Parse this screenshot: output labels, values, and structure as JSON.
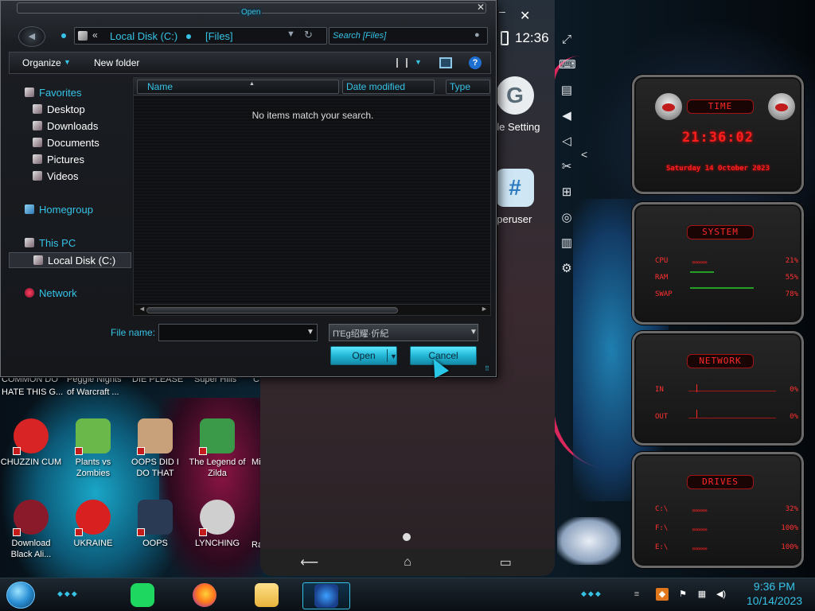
{
  "dialog": {
    "title": "Open",
    "address": {
      "crumb1": "Local Disk (C:)",
      "crumb2": "[Files]",
      "back_glyph": "«"
    },
    "search": {
      "placeholder": "Search [Files]"
    },
    "toolbar": {
      "organize_label": "Organize",
      "new_folder_label": "New folder",
      "help_glyph": "?"
    },
    "nav": {
      "favorites": "Favorites",
      "desktop": "Desktop",
      "downloads": "Downloads",
      "documents": "Documents",
      "pictures": "Pictures",
      "videos": "Videos",
      "homegroup": "Homegroup",
      "this_pc": "This PC",
      "local_disk": "Local Disk (C:)",
      "network": "Network"
    },
    "columns": {
      "name": "Name",
      "date_modified": "Date modified",
      "type": "Type"
    },
    "empty_message": "No items match your search.",
    "file_name_label": "File name:",
    "file_name_value": "",
    "file_type_value": "ΠΈg绍耀·伒紀",
    "open_label": "Open",
    "cancel_label": "Cancel"
  },
  "emulator": {
    "status_time": "12:36",
    "apps": {
      "google_settings": "gle Setting",
      "superuser": "uperuser",
      "google_glyph": "G",
      "superuser_glyph": "#"
    },
    "nav": {
      "back": "⟵",
      "home": "⌂",
      "recents": "▭"
    },
    "toolbar": [
      "⤢",
      "⌨",
      "▤",
      "◀",
      "◁",
      "✂",
      "⊞",
      "◎",
      "▥",
      "⚙"
    ],
    "close_glyph": "✕",
    "minimize_glyph": "–",
    "collapse_glyph": "<"
  },
  "sysmon": {
    "time_title": "TIME",
    "clock": "21:36:02",
    "date": "Saturday 14 October 2023",
    "system_title": "SYSTEM",
    "cpu_label": "CPU",
    "cpu_value": "21%",
    "ram_label": "RAM",
    "ram_value": "55%",
    "swap_label": "SWAP",
    "swap_value": "78%",
    "network_title": "NETWORK",
    "in_label": "IN",
    "in_value": "0%",
    "out_label": "OUT",
    "out_value": "0%",
    "drives_title": "DRIVES",
    "c_label": "C:\\",
    "c_value": "32%",
    "f_label": "F:\\",
    "f_value": "100%",
    "e_label": "E:\\",
    "e_value": "100%",
    "bar_glyphs": "»»»»»"
  },
  "desktop": {
    "partial_labels": [
      "COMMON DO",
      "Peggle Nights",
      "DIE PLEASE",
      "Super Hills",
      "C"
    ],
    "partial_labels2": [
      "HATE THIS G...",
      "of Warcraft ..."
    ],
    "icons_row1": [
      {
        "label": "CHUZZIN CUM",
        "color": "#d82424"
      },
      {
        "label": "Plants vs Zombies",
        "color": "#6bb84a"
      },
      {
        "label": "OOPS DID I DO THAT",
        "color": "#c8a07a"
      },
      {
        "label": "The Legend of Zilda",
        "color": "#3a9a4a"
      },
      {
        "label": "Mi"
      }
    ],
    "icons_row2": [
      {
        "label": "Download Black Ali...",
        "color": "#8a1a2a"
      },
      {
        "label": "UKRAINE",
        "color": "#d82020"
      },
      {
        "label": "OOPS",
        "color": "#2a3a55"
      },
      {
        "label": "LYNCHING",
        "color": "#cfcfcf"
      },
      {
        "label": "Ra"
      }
    ]
  },
  "taskbar": {
    "clock_time": "9:36 PM",
    "clock_date": "10/14/2023",
    "deco": "◆◆◆"
  }
}
